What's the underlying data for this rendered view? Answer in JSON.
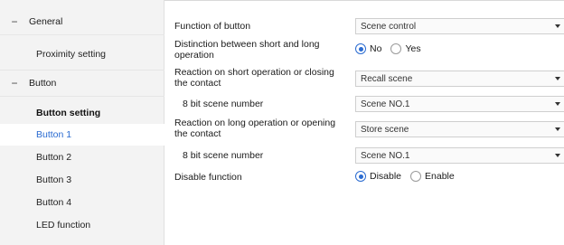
{
  "sidebar": {
    "groups": [
      {
        "label": "General",
        "collapse_symbol": "−"
      },
      {
        "label": "Button",
        "collapse_symbol": "−"
      }
    ],
    "items": [
      {
        "label": "Proximity setting"
      },
      {
        "label": "Button setting"
      },
      {
        "label": "Button 1"
      },
      {
        "label": "Button 2"
      },
      {
        "label": "Button 3"
      },
      {
        "label": "Button 4"
      },
      {
        "label": "LED function"
      }
    ],
    "selected_item": "Button 1"
  },
  "params": {
    "function_of_button": {
      "label": "Function of button",
      "value": "Scene control"
    },
    "distinction": {
      "label": "Distinction between short and long operation",
      "options": [
        "No",
        "Yes"
      ],
      "selected": "No"
    },
    "reaction_short": {
      "label": "Reaction on short operation or closing the contact",
      "value": "Recall scene"
    },
    "scene_number_short": {
      "label": "8 bit scene number",
      "value": "Scene NO.1"
    },
    "reaction_long": {
      "label": "Reaction on long operation or opening the contact",
      "value": "Store scene"
    },
    "scene_number_long": {
      "label": "8 bit scene number",
      "value": "Scene NO.1"
    },
    "disable_function": {
      "label": "Disable function",
      "options": [
        "Disable",
        "Enable"
      ],
      "selected": "Disable"
    }
  },
  "colors": {
    "accent": "#2a6bd1",
    "sidebar_bg": "#f3f3f3"
  }
}
